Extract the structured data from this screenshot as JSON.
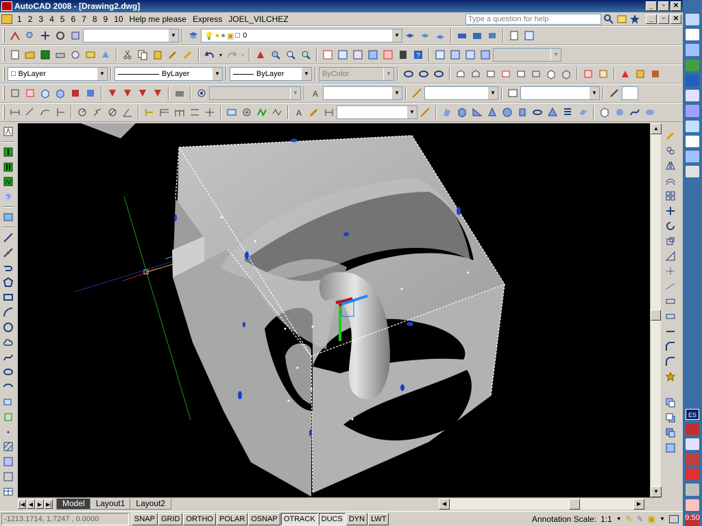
{
  "window": {
    "title": "AutoCAD 2008 - [Drawing2.dwg]",
    "minimize": "_",
    "restore": "▫",
    "close": "✕"
  },
  "menu": {
    "items": [
      "1",
      "2",
      "3",
      "4",
      "5",
      "6",
      "7",
      "8",
      "9",
      "10",
      "Help me please",
      "Express",
      "JOEL_VILCHEZ"
    ],
    "help_placeholder": "Type a question for help"
  },
  "toolbar_layers": {
    "workspace_value": "",
    "layer_value": "0"
  },
  "toolbar_properties": {
    "color_value": "ByLayer",
    "linetype_value": "ByLayer",
    "lineweight_value": "ByLayer",
    "plotstyle_value": "ByColor"
  },
  "tabs": {
    "model": "Model",
    "layout1": "Layout1",
    "layout2": "Layout2"
  },
  "status": {
    "coords": "-1213.1714, 1.7247 , 0.0000",
    "toggles": [
      {
        "label": "SNAP",
        "on": false
      },
      {
        "label": "GRID",
        "on": false
      },
      {
        "label": "ORTHO",
        "on": false
      },
      {
        "label": "POLAR",
        "on": false
      },
      {
        "label": "OSNAP",
        "on": false
      },
      {
        "label": "OTRACK",
        "on": true
      },
      {
        "label": "DUCS",
        "on": true
      },
      {
        "label": "DYN",
        "on": false
      },
      {
        "label": "LWT",
        "on": false
      }
    ],
    "annotation_label": "Annotation Scale:",
    "annotation_value": "1:1"
  },
  "taskbar": {
    "language": "ES",
    "time": "9:50"
  },
  "colors": {
    "title_bar": "#0a246a",
    "viewport_bg": "#000000",
    "solid_face": "#b8b8b8",
    "grip_blue": "#1a3fd0",
    "ucs_x": "#cc0000",
    "ucs_y": "#00cc00",
    "ucs_z": "#1a8fff"
  }
}
